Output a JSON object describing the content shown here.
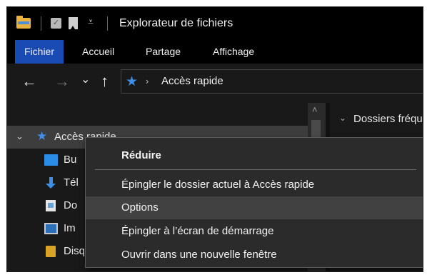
{
  "window": {
    "title": "Explorateur de fichiers"
  },
  "titlebar": {
    "icons": [
      "folder-icon",
      "properties-check-icon",
      "new-folder-icon",
      "customize-dropdown-icon"
    ],
    "dropdown_glyph": "⩡"
  },
  "ribbon": {
    "tabs": [
      {
        "label": "Fichier",
        "active": true
      },
      {
        "label": "Accueil",
        "active": false
      },
      {
        "label": "Partage",
        "active": false
      },
      {
        "label": "Affichage",
        "active": false
      }
    ]
  },
  "navigation": {
    "back": "←",
    "forward": "→",
    "recent": "⌄",
    "up": "↑"
  },
  "address": {
    "star": "★",
    "chevron": "›",
    "path": "Accès rapide"
  },
  "nav_pane": {
    "quick_access": {
      "chevron": "⌄",
      "star": "★",
      "label": "Accès rapide"
    },
    "items": [
      {
        "icon": "desktop-icon",
        "label": "Bu"
      },
      {
        "icon": "download-icon",
        "label": "Tél"
      },
      {
        "icon": "document-icon",
        "label": "Do"
      },
      {
        "icon": "image-icon",
        "label": "Im"
      },
      {
        "icon": "drive-icon",
        "label": "Disq"
      }
    ]
  },
  "scrollbar": {
    "up_glyph": "˄"
  },
  "content": {
    "chevron": "⌄",
    "header": "Dossiers fréquents"
  },
  "context_menu": {
    "title": "Réduire",
    "items": [
      {
        "label": "Épingler le dossier actuel à Accès rapide",
        "highlighted": false
      },
      {
        "label": "Options",
        "highlighted": true
      },
      {
        "label": "Épingler à l’écran de démarrage",
        "highlighted": false
      },
      {
        "label": "Ouvrir dans une nouvelle fenêtre",
        "highlighted": false
      }
    ]
  },
  "colors": {
    "window_bg": "#191919",
    "titlebar_bg": "#000000",
    "active_tab": "#1a4ab3",
    "selected_row": "#3d3d3d",
    "menu_bg": "#2b2b2b",
    "menu_hover": "#414141",
    "star_blue": "#3c8ee8"
  }
}
